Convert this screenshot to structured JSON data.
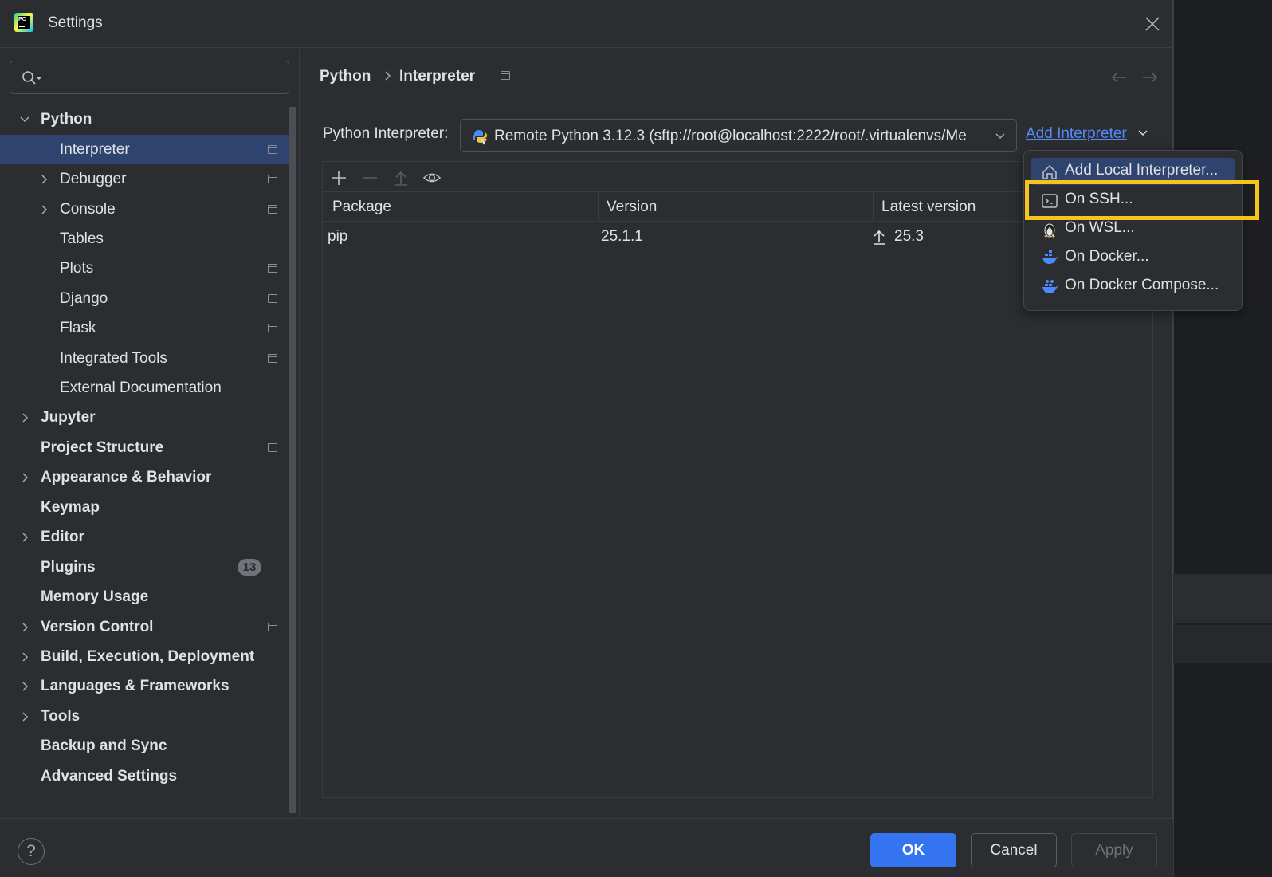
{
  "window": {
    "title": "Settings"
  },
  "search": {
    "placeholder": ""
  },
  "sidebar": {
    "items": [
      {
        "label": "Python"
      },
      {
        "label": "Interpreter"
      },
      {
        "label": "Debugger"
      },
      {
        "label": "Console"
      },
      {
        "label": "Tables"
      },
      {
        "label": "Plots"
      },
      {
        "label": "Django"
      },
      {
        "label": "Flask"
      },
      {
        "label": "Integrated Tools"
      },
      {
        "label": "External Documentation"
      },
      {
        "label": "Jupyter"
      },
      {
        "label": "Project Structure"
      },
      {
        "label": "Appearance & Behavior"
      },
      {
        "label": "Keymap"
      },
      {
        "label": "Editor"
      },
      {
        "label": "Plugins",
        "badge": "13"
      },
      {
        "label": "Memory Usage"
      },
      {
        "label": "Version Control"
      },
      {
        "label": "Build, Execution, Deployment"
      },
      {
        "label": "Languages & Frameworks"
      },
      {
        "label": "Tools"
      },
      {
        "label": "Backup and Sync"
      },
      {
        "label": "Advanced Settings"
      }
    ]
  },
  "breadcrumb": {
    "parent": "Python",
    "current": "Interpreter"
  },
  "interpreter": {
    "label": "Python Interpreter:",
    "value": "Remote Python 3.12.3 (sftp://root@localhost:2222/root/.virtualenvs/Me",
    "add_link": "Add Interpreter"
  },
  "packages": {
    "columns": [
      "Package",
      "Version",
      "Latest version"
    ],
    "rows": [
      {
        "package": "pip",
        "version": "25.1.1",
        "latest": "25.3"
      }
    ]
  },
  "add_menu": {
    "items": [
      {
        "label": "Add Local Interpreter...",
        "icon": "home-icon"
      },
      {
        "label": "On SSH...",
        "icon": "terminal-icon"
      },
      {
        "label": "On WSL...",
        "icon": "linux-penguin-icon"
      },
      {
        "label": "On Docker...",
        "icon": "docker-icon"
      },
      {
        "label": "On Docker Compose...",
        "icon": "docker-compose-icon"
      }
    ]
  },
  "footer": {
    "ok": "OK",
    "cancel": "Cancel",
    "apply": "Apply",
    "help": "?"
  },
  "colors": {
    "accent": "#3574f0",
    "selection": "#2e436e",
    "highlight": "#f7c41d",
    "link": "#548af7"
  }
}
